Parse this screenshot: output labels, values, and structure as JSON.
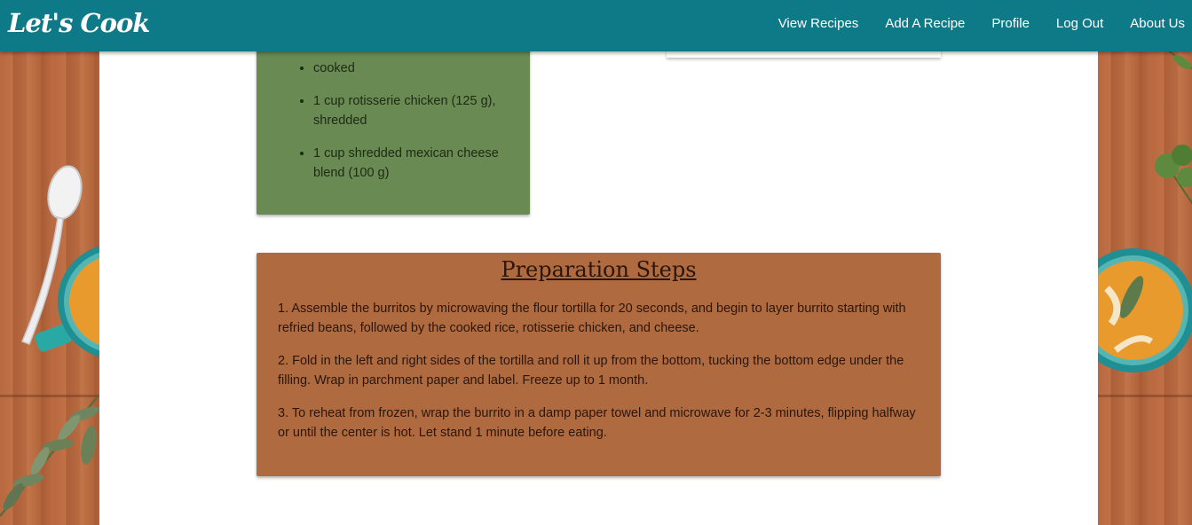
{
  "navbar": {
    "brand": "Let's Cook",
    "links": [
      "View Recipes",
      "Add A Recipe",
      "Profile",
      "Log Out",
      "About Us"
    ]
  },
  "ingredients": {
    "items": [
      "cooked",
      "1 cup rotisserie chicken (125 g), shredded",
      "1 cup shredded mexican cheese blend (100 g)"
    ]
  },
  "preparation": {
    "title": "Preparation Steps",
    "steps": [
      "1. Assemble the burritos by microwaving the flour tortilla for 20 seconds, and begin to layer burrito starting with refried beans, followed by the cooked rice, rotisserie chicken, and cheese.",
      "2. Fold in the left and right sides of the tortilla and roll it up from the bottom, tucking the bottom edge under the filling. Wrap in parchment paper and label. Freeze up to 1 month.",
      "3. To reheat from frozen, wrap the burrito in a damp paper towel and microwave for 2-3 minutes, flipping halfway or until the center is hot. Let stand 1 minute before eating."
    ]
  },
  "colors": {
    "navbar": "#0e7a87",
    "ingredients_card": "#698a52",
    "preparation_card": "#b06a3f",
    "wood": "#b86a3e"
  }
}
